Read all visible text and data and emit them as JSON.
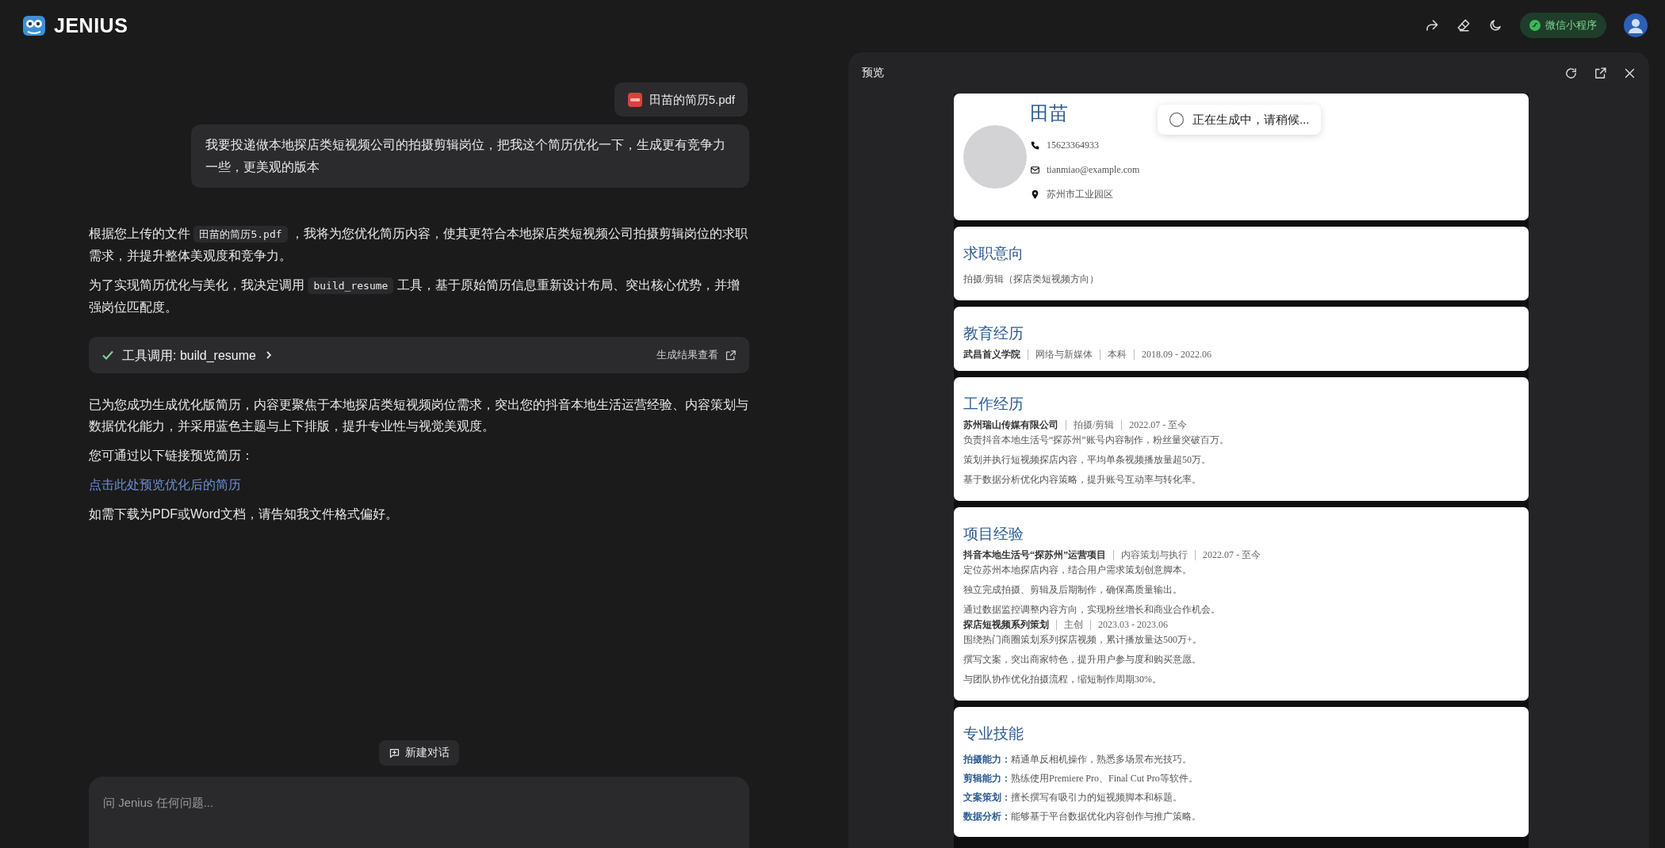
{
  "header": {
    "brand": "JENIUS",
    "mini_program": "微信小程序"
  },
  "chat": {
    "attachment": {
      "name": "田苗的简历5.pdf"
    },
    "user_message": "我要投递做本地探店类短视频公司的拍摄剪辑岗位，把我这个简历优化一下，生成更有竞争力一些，更美观的版本",
    "intro_paragraphs": [
      [
        {
          "kind": "text",
          "text": "根据您上传的文件 "
        },
        {
          "kind": "code",
          "text": "田苗的简历5.pdf"
        },
        {
          "kind": "text",
          "text": " ，我将为您优化简历内容，使其更符合本地探店类短视频公司拍摄剪辑岗位的求职需求，并提升整体美观度和竞争力。"
        }
      ],
      [
        {
          "kind": "text",
          "text": "为了实现简历优化与美化，我决定调用 "
        },
        {
          "kind": "code",
          "text": "build_resume"
        },
        {
          "kind": "text",
          "text": " 工具，基于原始简历信息重新设计布局、突出核心优势，并增强岗位匹配度。"
        }
      ]
    ],
    "tool_call": {
      "label": "工具调用: build_resume",
      "action": "生成结果查看"
    },
    "result_blocks": [
      {
        "kind": "text",
        "text": "已为您成功生成优化版简历，内容更聚焦于本地探店类短视频岗位需求，突出您的抖音本地生活运营经验、内容策划与数据优化能力，并采用蓝色主题与上下排版，提升专业性与视觉美观度。"
      },
      {
        "kind": "text",
        "text": "您可通过以下链接预览简历："
      },
      {
        "kind": "link",
        "text": "点击此处预览优化后的简历"
      },
      {
        "kind": "text",
        "text": "如需下载为PDF或Word文档，请告知我文件格式偏好。"
      }
    ],
    "new_chat_button": "新建对话",
    "input": {
      "placeholder": "问 Jenius 任何问题..."
    }
  },
  "preview": {
    "title": "预览",
    "status": "正在生成中，请稍候...",
    "resume": {
      "name": "田苗",
      "phone": "15623364933",
      "email": "tianmiao@example.com",
      "location": "苏州市工业园区",
      "sections": [
        {
          "kind": "text",
          "title": "求职意向",
          "text": "拍摄/剪辑（探店类短视频方向）"
        },
        {
          "kind": "entries",
          "title": "教育经历",
          "entries": [
            {
              "meta": [
                "武昌首义学院",
                "网络与新媒体",
                "本科",
                "2018.09 - 2022.06"
              ]
            }
          ]
        },
        {
          "kind": "entries",
          "title": "工作经历",
          "entries": [
            {
              "meta": [
                "苏州瑞山传媒有限公司",
                "拍摄/剪辑",
                "2022.07 - 至今"
              ],
              "bullets": [
                "负责抖音本地生活号“探苏州”账号内容制作，粉丝量突破百万。",
                "策划并执行短视频探店内容，平均单条视频播放量超50万。",
                "基于数据分析优化内容策略，提升账号互动率与转化率。"
              ]
            }
          ]
        },
        {
          "kind": "entries",
          "title": "项目经验",
          "entries": [
            {
              "meta": [
                "抖音本地生活号“探苏州”运营项目",
                "内容策划与执行",
                "2022.07 - 至今"
              ],
              "bullets": [
                "定位苏州本地探店内容，结合用户需求策划创意脚本。",
                "独立完成拍摄、剪辑及后期制作，确保高质量输出。",
                "通过数据监控调整内容方向，实现粉丝增长和商业合作机会。"
              ]
            },
            {
              "meta": [
                "探店短视频系列策划",
                "主创",
                "2023.03 - 2023.06"
              ],
              "bullets": [
                "围绕热门商圈策划系列探店视频，累计播放量达500万+。",
                "撰写文案，突出商家特色，提升用户参与度和购买意愿。",
                "与团队协作优化拍摄流程，缩短制作周期30%。"
              ]
            }
          ]
        },
        {
          "kind": "skills",
          "title": "专业技能",
          "items": [
            {
              "label": "拍摄能力：",
              "text": "精通单反相机操作，熟悉多场景布光技巧。"
            },
            {
              "label": "剪辑能力：",
              "text": "熟练使用Premiere Pro、Final Cut Pro等软件。"
            },
            {
              "label": "文案策划：",
              "text": "擅长撰写有吸引力的短视频脚本和标题。"
            },
            {
              "label": "数据分析：",
              "text": "能够基于平台数据优化内容创作与推广策略。"
            }
          ]
        }
      ]
    }
  }
}
